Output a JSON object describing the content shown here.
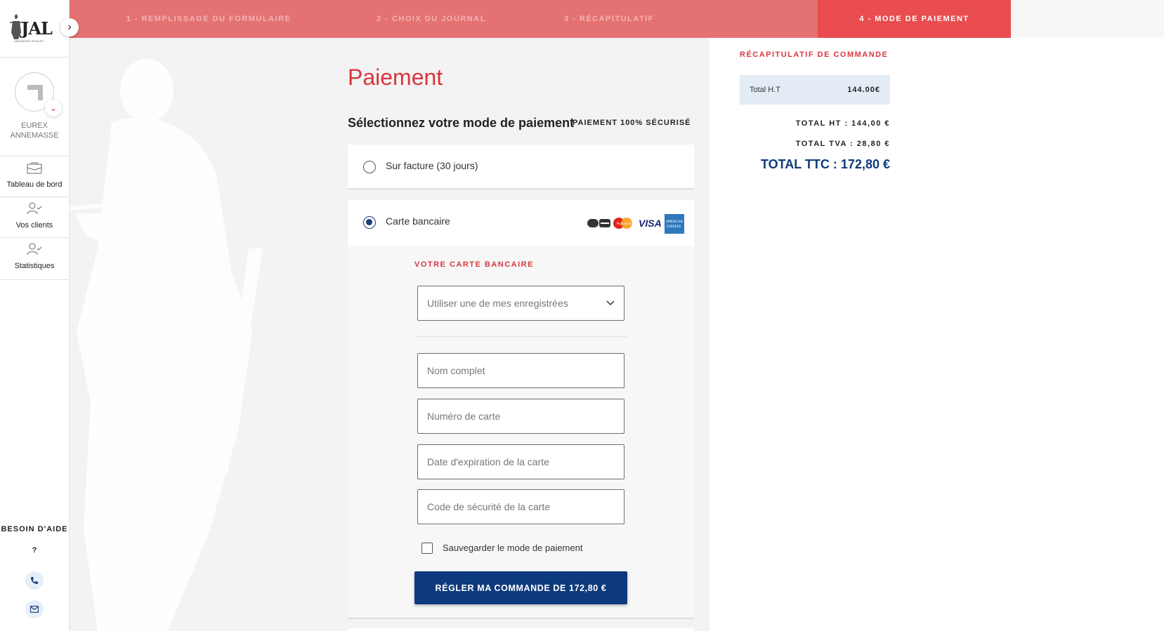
{
  "sidebar": {
    "logo_text": "JAL",
    "logo_subtitle": "ANNONCES LÉGALES",
    "account_name": "EUREX\nANNEMASSE",
    "nav": [
      {
        "label": "Tableau de bord",
        "icon": "briefcase-icon"
      },
      {
        "label": "Vos clients",
        "icon": "user-check-icon"
      },
      {
        "label": "Statistiques",
        "icon": "user-check-icon"
      }
    ],
    "help_title": "BESOIN D'AIDE",
    "help_question": "?"
  },
  "steps": [
    {
      "label": "1 - REMPLISSAGE DU FORMULAIRE",
      "active": false
    },
    {
      "label": "2 - CHOIX DU JOURNAL",
      "active": false
    },
    {
      "label": "3 - RÉCAPITULATIF",
      "active": false
    },
    {
      "label": "4 - MODE DE PAIEMENT",
      "active": true
    }
  ],
  "main": {
    "title": "Paiement",
    "section_title": "Sélectionnez votre mode de paiement",
    "secure_badge": "PAIEMENT 100% SÉCURISÉ",
    "options": [
      {
        "label": "Sur facture (30 jours)",
        "selected": false
      },
      {
        "label": "Carte bancaire",
        "selected": true
      }
    ],
    "card_logos": [
      "CB",
      "MasterCard",
      "VISA",
      "AMERICAN EXPRESS"
    ],
    "card_panel": {
      "heading": "VOTRE CARTE BANCAIRE",
      "saved_cards_placeholder": "Utiliser une de mes enregistrées",
      "name_placeholder": "Nom complet",
      "number_placeholder": "Numéro de carte",
      "expiry_placeholder": "Date d'expiration de la carte",
      "cvc_placeholder": "Code de sécurité de la carte",
      "save_label": "Sauvegarder le mode de paiement",
      "save_checked": false,
      "pay_button": "RÉGLER MA COMMANDE DE 172,80 €"
    }
  },
  "summary": {
    "heading": "RÉCAPITULATIF DE COMMANDE",
    "row_label": "Total H.T",
    "row_value": "144.00€",
    "total_ht": "TOTAL HT : 144,00 €",
    "total_tva": "TOTAL TVA : 28,80 €",
    "total_ttc": "TOTAL TTC : 172,80 €"
  },
  "colors": {
    "brand_red": "#d9363e",
    "step_bar": "#e47273",
    "step_active": "#e94d4f",
    "primary_navy": "#0d3a7d",
    "summary_row_bg": "#e3ecf4"
  }
}
